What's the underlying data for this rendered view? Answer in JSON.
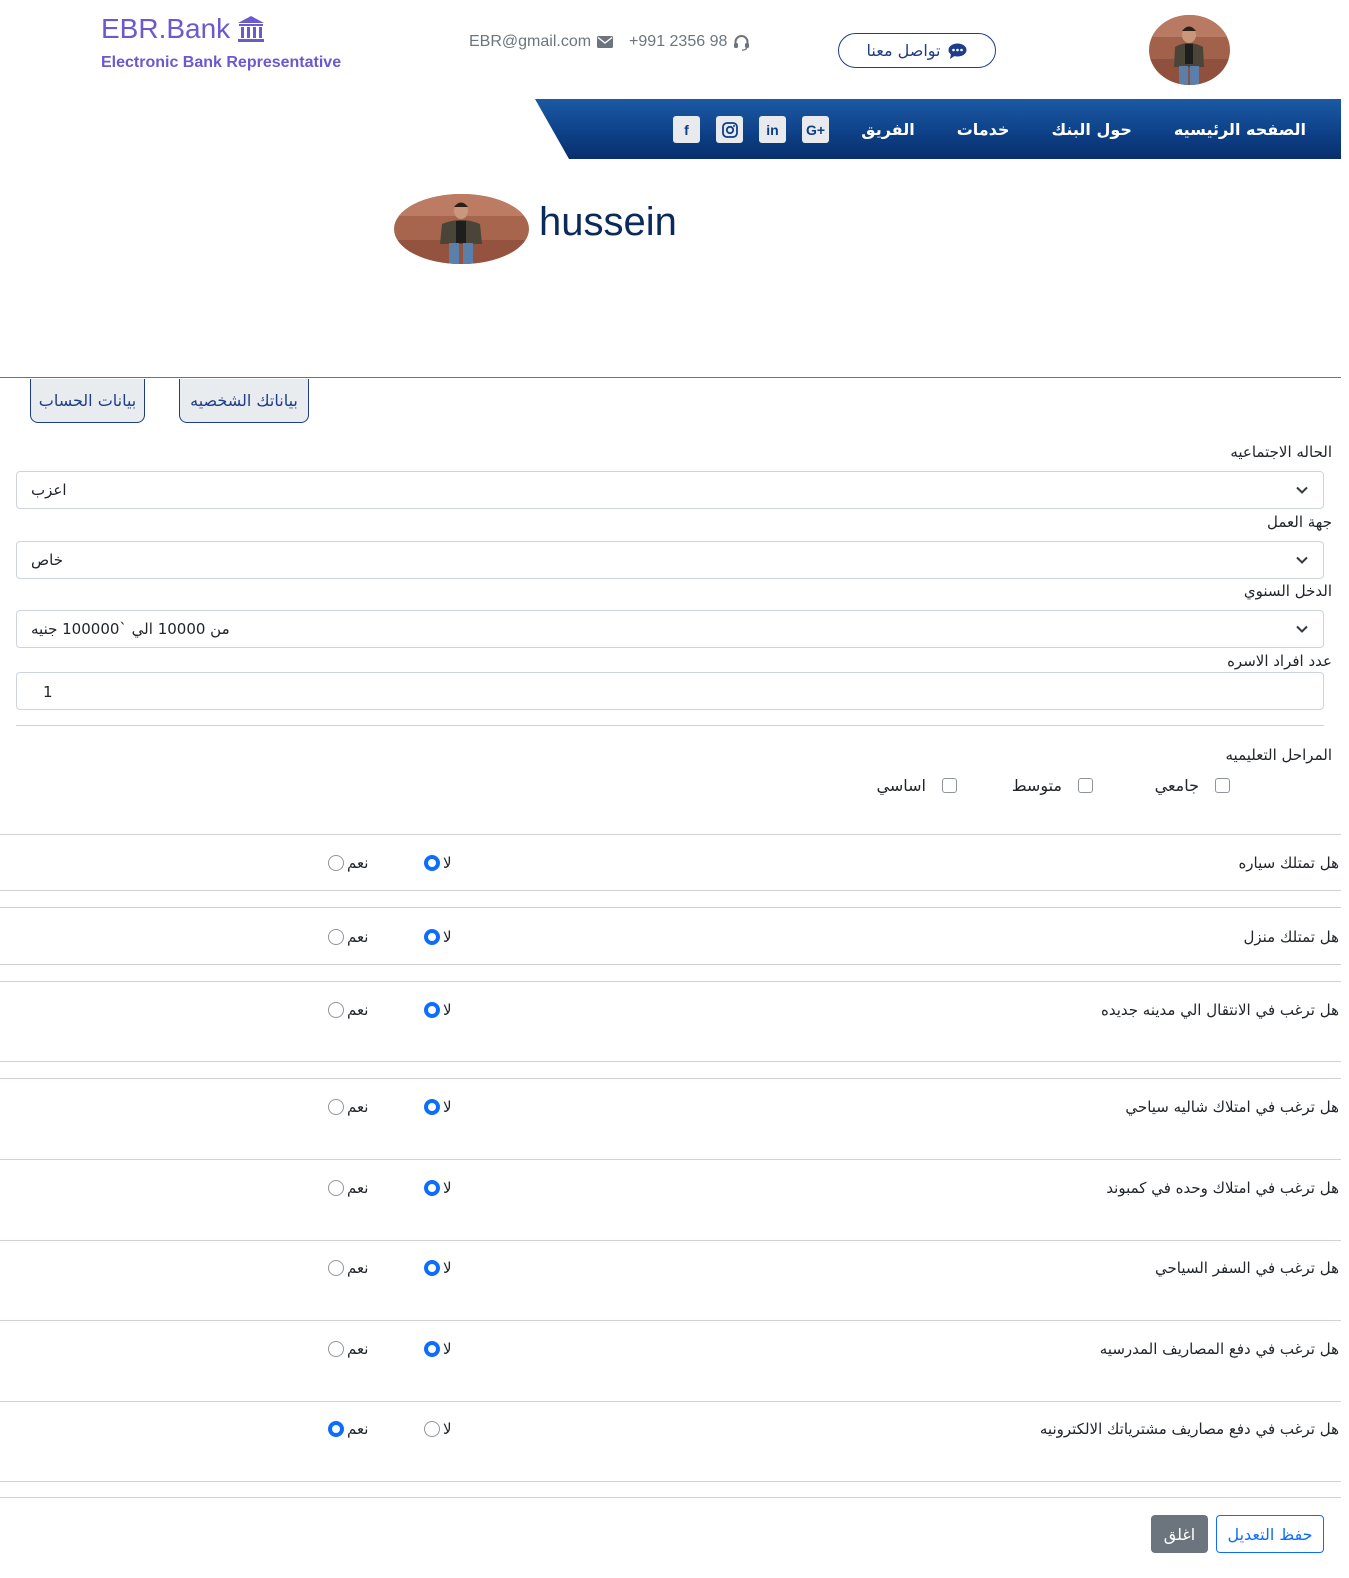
{
  "brand": {
    "name": "EBR.Bank",
    "subtitle": "Electronic Bank Representative",
    "icon": "bank-icon"
  },
  "contact": {
    "email": "EBR@gmail.com",
    "phone": "+991 2356 98",
    "button_label": "تواصل معنا"
  },
  "nav": {
    "items": [
      "الصفحه الرئيسيه",
      "حول البنك",
      "خدمات",
      "الفريق"
    ]
  },
  "socials": [
    "facebook-icon",
    "instagram-icon",
    "linkedin-icon",
    "google-plus-icon"
  ],
  "profile": {
    "name": "hussein"
  },
  "tabs": {
    "personal": "بياناتك الشخصيه",
    "account": "بيانات الحساب"
  },
  "form": {
    "marital_label": "الحاله الاجتماعيه",
    "marital_value": "اعزب",
    "work_label": "جهة العمل",
    "work_value": "خاص",
    "income_label": "الدخل السنوي",
    "income_value": "من 10000 الي `100000 جنيه",
    "family_label": "عدد افراد الاسره",
    "family_value": "1",
    "education_label": "المراحل التعليميه",
    "education_options": [
      "جامعي",
      "متوسط",
      "اساسي"
    ]
  },
  "questions": [
    {
      "text": "هل تمتلك سياره",
      "no": "لا",
      "yes": "نعم",
      "selected": "no"
    },
    {
      "text": "هل تمتلك منزل",
      "no": "لا",
      "yes": "نعم",
      "selected": "no"
    },
    {
      "text": "هل ترغب في الانتقال الي مدينه جديده",
      "no": "لا",
      "yes": "نعم",
      "selected": "no"
    },
    {
      "text": "هل ترغب في امتلاك شاليه سياحي",
      "no": "لا",
      "yes": "نعم",
      "selected": "no"
    },
    {
      "text": "هل ترغب في امتلاك وحده في كمبوند",
      "no": "لا",
      "yes": "نعم",
      "selected": "no"
    },
    {
      "text": "هل ترغب في السفر السياحي",
      "no": "لا",
      "yes": "نعم",
      "selected": "no"
    },
    {
      "text": "هل ترغب في دفع المصاريف المدرسيه",
      "no": "لا",
      "yes": "نعم",
      "selected": "no"
    },
    {
      "text": "هل ترغب في دفع مصاريف مشترياتك الالكترونيه",
      "no": "لا",
      "yes": "نعم",
      "selected": "yes"
    }
  ],
  "buttons": {
    "save": "حفظ التعديل",
    "close": "اغلق"
  },
  "colors": {
    "brand": "#6a5acd",
    "nav": "#0d3f86",
    "primary": "#0d6efd"
  }
}
